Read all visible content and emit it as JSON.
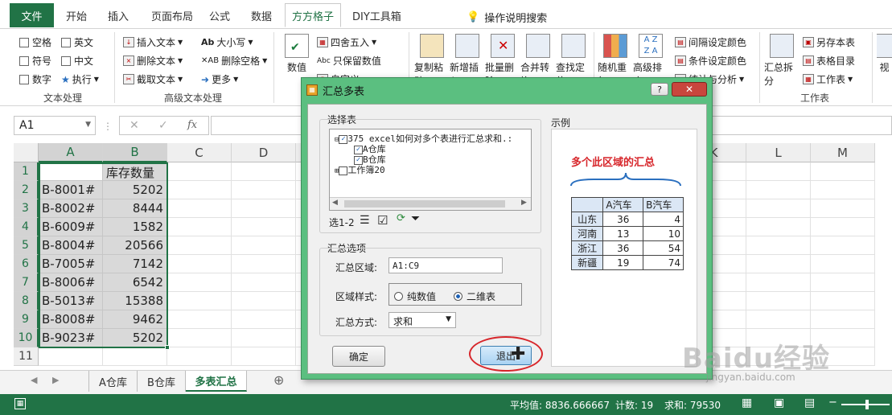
{
  "ribbon_tabs": [
    "开始",
    "插入",
    "页面布局",
    "公式",
    "数据",
    "方方格子",
    "DIY工具箱"
  ],
  "file_tab": "文件",
  "active_tab": "方方格子",
  "tell_me": "操作说明搜索",
  "text_group": {
    "checkboxes": [
      "空格",
      "英文",
      "符号",
      "中文",
      "数字"
    ],
    "execute": "执行",
    "label": "文本处理"
  },
  "adv_text": {
    "insert": "插入文本",
    "delete": "删除文本",
    "extract": "截取文本",
    "case": "大小写",
    "del_space": "删除空格",
    "more": "更多",
    "label": "高级文本处理"
  },
  "numbers": {
    "value": "数值",
    "round": "四舍五入",
    "keep_value": "只保留数值",
    "custom": "自定义"
  },
  "edit": {
    "copy": "复制粘贴",
    "insert": "新增插入",
    "batch_del": "批量删除",
    "merge": "合并转换",
    "find": "查找定位",
    "label": "编辑"
  },
  "data_an": {
    "random": "随机重复",
    "adv_sort": "高级排序",
    "interval": "间隔设定颜色",
    "cond": "条件设定颜色",
    "stats": "统计与分析",
    "label": "数据分析"
  },
  "workbook": {
    "summary": "汇总拆分",
    "save_as": "另存本表",
    "toc": "表格目录",
    "sheet": "工作表",
    "label": "工作表"
  },
  "view": "视",
  "namebox": "A1",
  "columns": [
    "A",
    "B",
    "C",
    "D",
    "E",
    "F",
    "G",
    "H",
    "I",
    "J",
    "K",
    "L",
    "M"
  ],
  "rows": [
    {
      "n": "1",
      "a": "",
      "b": "库存数量"
    },
    {
      "n": "2",
      "a": "B-8001#",
      "b": "5202"
    },
    {
      "n": "3",
      "a": "B-8002#",
      "b": "8444"
    },
    {
      "n": "4",
      "a": "B-6009#",
      "b": "1582"
    },
    {
      "n": "5",
      "a": "B-8004#",
      "b": "20566"
    },
    {
      "n": "6",
      "a": "B-7005#",
      "b": "7142"
    },
    {
      "n": "7",
      "a": "B-8006#",
      "b": "6542"
    },
    {
      "n": "8",
      "a": "B-5013#",
      "b": "15388"
    },
    {
      "n": "9",
      "a": "B-8008#",
      "b": "9462"
    },
    {
      "n": "10",
      "a": "B-9023#",
      "b": "5202"
    },
    {
      "n": "11",
      "a": "",
      "b": ""
    }
  ],
  "sheets": [
    "A仓库",
    "B仓库",
    "多表汇总"
  ],
  "status": {
    "avg": "平均值: 8836.666667",
    "count": "计数: 19",
    "sum": "求和: 79530"
  },
  "dialog": {
    "title": "汇总多表",
    "select_label": "选择表",
    "tree": [
      "375 excel如何对多个表进行汇总求和.:",
      "A仓库",
      "B仓库",
      "工作簿20"
    ],
    "selected_count": "选1-2",
    "options_label": "汇总选项",
    "range_label": "汇总区域:",
    "range_value": "A1:C9",
    "style_label": "区域样式:",
    "style_opt1": "纯数值",
    "style_opt2": "二维表",
    "method_label": "汇总方式:",
    "method_value": "求和",
    "ok": "确定",
    "exit": "退出",
    "example_label": "示例",
    "example_caption": "多个此区域的汇总",
    "example_header": [
      "",
      "A汽车",
      "B汽车"
    ],
    "example_rows": [
      [
        "山东",
        "36",
        "4"
      ],
      [
        "河南",
        "13",
        "10"
      ],
      [
        "浙江",
        "36",
        "54"
      ],
      [
        "新疆",
        "19",
        "74"
      ]
    ]
  },
  "watermark": "Baidu经验",
  "watermark_url": "jingyan.baidu.com"
}
